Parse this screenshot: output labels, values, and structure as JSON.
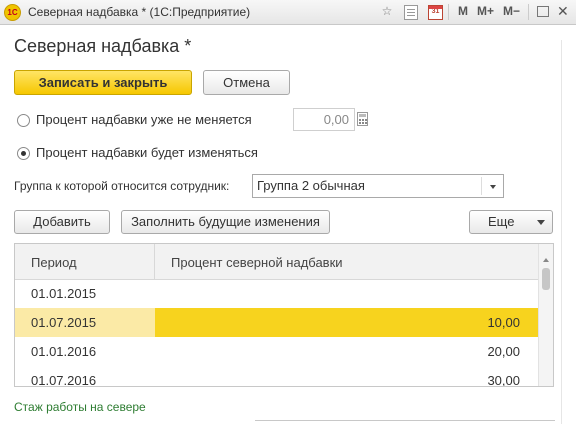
{
  "window": {
    "title": "Северная надбавка * (1С:Предприятие)",
    "logo_text": "1С",
    "tb_m": "M",
    "tb_mplus": "M+",
    "tb_mminus": "M−",
    "close": "✕"
  },
  "form": {
    "title": "Северная надбавка *",
    "save_close_label": "Записать и закрыть",
    "cancel_label": "Отмена"
  },
  "options": {
    "fixed_label": "Процент надбавки уже не меняется",
    "fixed_value": "0,00",
    "changing_label": "Процент надбавки будет изменяться",
    "selected": "changing"
  },
  "group": {
    "label": "Группа к которой относится сотрудник:",
    "value": "Группа 2 обычная"
  },
  "toolbar": {
    "add_label": "Добавить",
    "fill_label": "Заполнить будущие изменения",
    "more_label": "Еще"
  },
  "table": {
    "columns": [
      "Период",
      "Процент северной надбавки"
    ],
    "rows": [
      {
        "period": "01.01.2015",
        "percent": ""
      },
      {
        "period": "01.07.2015",
        "percent": "10,00"
      },
      {
        "period": "01.01.2016",
        "percent": "20,00"
      },
      {
        "period": "01.07.2016",
        "percent": "30,00"
      }
    ],
    "selected_row": 1
  },
  "footer": {
    "link": "Стаж работы на севере"
  },
  "colors": {
    "accent": "#f6c700",
    "selected_row": "#f7d31e",
    "link": "#2e7d32"
  }
}
